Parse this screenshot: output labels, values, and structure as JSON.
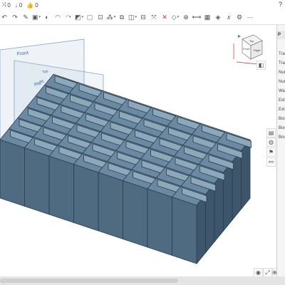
{
  "stats": {
    "a": "0",
    "b": "0",
    "likes": "0"
  },
  "help": "?",
  "planes": {
    "front": "Front",
    "right": "Right",
    "top": "Top"
  },
  "viewcube": {
    "top": "Top",
    "front": "Front",
    "right": "Right"
  },
  "panel": {
    "header": "P",
    "rows": [
      "Tra",
      "Tra",
      "Nur",
      "Nur",
      "Wal",
      "Ext",
      "Ext",
      "Box",
      "Box",
      "Box"
    ]
  },
  "grid": {
    "rows": 6,
    "cols": 8
  },
  "colors": {
    "cell_top": "#6a8aa3",
    "cell_inner": "#8ea8bb",
    "wall_front": "#4f6b82",
    "wall_side": "#3e566b"
  }
}
